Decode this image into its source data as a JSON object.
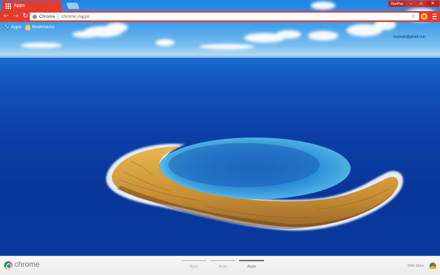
{
  "tab": {
    "title": "Apps"
  },
  "window": {
    "user": "DeePay",
    "minimize": "–",
    "maximize": "▫",
    "close": "✕"
  },
  "toolbar": {
    "back_icon": "arrow-left-icon",
    "forward_icon": "arrow-right-icon",
    "reload_icon": "reload-icon",
    "site_label": "Chrome",
    "url": "chrome://apps",
    "star": "☆"
  },
  "bookmarks": {
    "items": [
      {
        "label": "Apps",
        "icon": "apps-grid-icon"
      },
      {
        "label": "Bookmarks",
        "icon": "folder-icon"
      }
    ]
  },
  "account": {
    "email": "example@gmail.com"
  },
  "bottom_bar": {
    "brand": "chrome",
    "pages": [
      {
        "label": "Apps",
        "active": false
      },
      {
        "label": "Apps",
        "active": false
      },
      {
        "label": "Apps",
        "active": true
      }
    ],
    "web_store": "Web Store"
  },
  "colors": {
    "accent": "#e63a2e",
    "ocean": "#0b3fa6",
    "sky": "#2f8fe4",
    "island": "#d9a640"
  }
}
